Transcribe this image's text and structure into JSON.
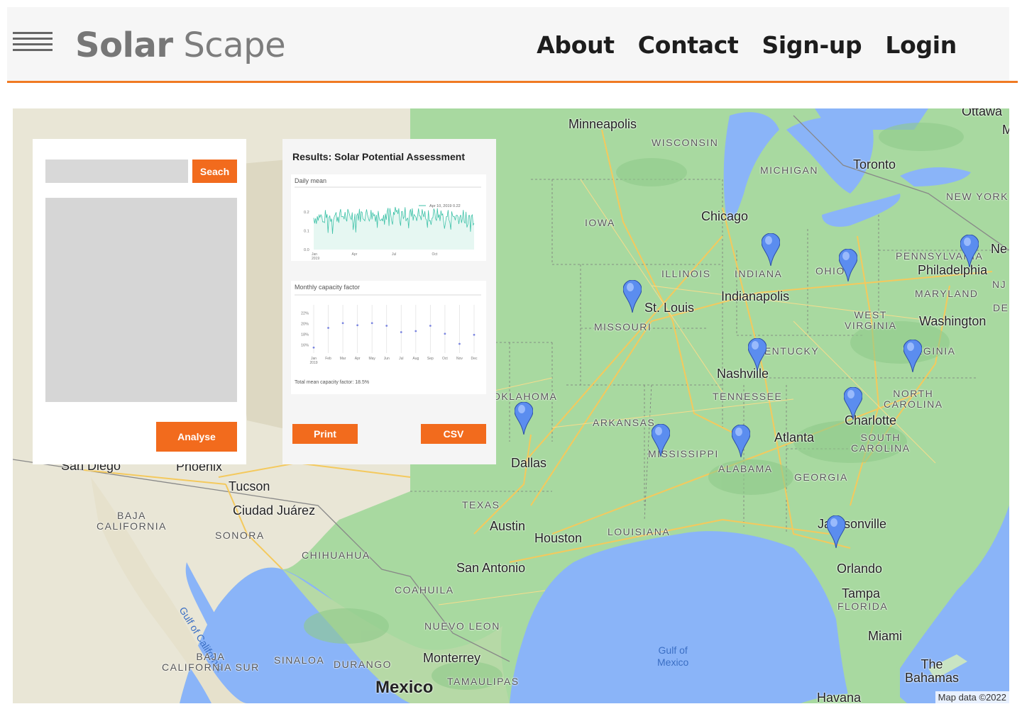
{
  "header": {
    "brand_bold": "Solar",
    "brand_light": "Scape",
    "nav": [
      "About",
      "Contact",
      "Sign-up",
      "Login"
    ],
    "accent_color": "#f07a23"
  },
  "search_panel": {
    "search_button": "Seach",
    "analyse_button": "Analyse"
  },
  "results_panel": {
    "title": "Results: Solar Potential Assessment",
    "daily_title": "Daily mean",
    "daily_legend": "Apr 10, 2019  0.22",
    "daily_yticks": [
      "0.2",
      "0.1",
      "0.0"
    ],
    "daily_xticks": [
      "Jan\n2019",
      "Apr",
      "Jul",
      "Oct"
    ],
    "monthly_title": "Monthly capacity factor",
    "monthly_yticks": [
      "22%",
      "20%",
      "18%",
      "16%"
    ],
    "total_mean": "Total mean capacity factor: 18.5%",
    "print_button": "Print",
    "csv_button": "CSV"
  },
  "chart_data": [
    {
      "type": "line",
      "title": "Daily mean",
      "x_range": [
        "Jan 2019",
        "Dec 2019"
      ],
      "ylim": [
        0,
        0.25
      ],
      "annotation": "Apr 10, 2019 0.22"
    },
    {
      "type": "scatter",
      "title": "Monthly capacity factor",
      "categories": [
        "Jan 2019",
        "Feb",
        "Mar",
        "Apr",
        "May",
        "Jun",
        "Jul",
        "Aug",
        "Sep",
        "Oct",
        "Nov",
        "Dec"
      ],
      "values": [
        15.5,
        19.2,
        20.1,
        19.7,
        20.1,
        19.6,
        18.4,
        18.6,
        19.6,
        18.1,
        16.2,
        17.9
      ],
      "ylim": [
        15,
        23
      ],
      "ylabel_unit": "%"
    }
  ],
  "map": {
    "attribution": "Map data ©2022",
    "labels": {
      "minneapolis": "Minneapolis",
      "wisconsin": "WISCONSIN",
      "michigan": "MICHIGAN",
      "toronto": "Toronto",
      "ottawa": "Ottawa",
      "newyork": "NEW YORK",
      "iowa": "IOWA",
      "chicago": "Chicago",
      "pennsylvania": "PENNSYLVANIA",
      "philadelphia": "Philadelphia",
      "illinois": "ILLINOIS",
      "indiana": "INDIANA",
      "ohio": "OHIO",
      "indianapolis": "Indianapolis",
      "maryland": "MARYLAND",
      "stlouis": "St. Louis",
      "missouri": "MISSOURI",
      "westvirginia": "WEST\nVIRGINIA",
      "washington": "Washington",
      "kentucky": "KENTUCKY",
      "virginia": "VIRGINIA",
      "nashville": "Nashville",
      "tennessee": "TENNESSEE",
      "northcarolina": "NORTH\nCAROLINA",
      "oklahoma": "OKLAHOMA",
      "arkansas": "ARKANSAS",
      "charlotte": "Charlotte",
      "atlanta": "Atlanta",
      "mississippi": "MISSISSIPPI",
      "southcarolina": "SOUTH\nCAROLINA",
      "alabama": "ALABAMA",
      "dallas": "Dallas",
      "georgia": "GEORGIA",
      "sandiego": "San Diego",
      "phoenix": "Phoenix",
      "tucson": "Tucson",
      "ciudadjuarez": "Ciudad Juárez",
      "texas": "TEXAS",
      "bajacalifornia": "BAJA\nCALIFORNIA",
      "sonora": "SONORA",
      "austin": "Austin",
      "houston": "Houston",
      "louisiana": "LOUISIANA",
      "jacksonville": "Jacksonville",
      "chihuahua": "CHIHUAHUA",
      "sanantonio": "San Antonio",
      "orlando": "Orlando",
      "tampa": "Tampa",
      "florida": "FLORIDA",
      "coahuila": "COAHUILA",
      "gulfcalifornia": "Gulf of California",
      "nuevoleon": "NUEVO LEON",
      "miami": "Miami",
      "gulfmexico": "Gulf of\nMexico",
      "bajasur": "BAJA\nCALIFORNIA SUR",
      "sinaloa": "SINALOA",
      "durango": "DURANGO",
      "monterrey": "Monterrey",
      "thebahamas": "The\nBahamas",
      "mexico": "Mexico",
      "tamaulipas": "TAMAULIPAS",
      "havana": "Havana",
      "ny_abbr": "Ne",
      "de": "DE",
      "nj": "NJ",
      "m_edge": "M"
    }
  }
}
